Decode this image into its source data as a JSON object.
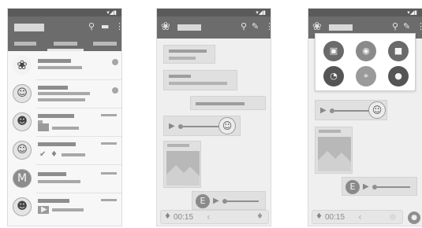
{
  "status": {
    "icons": "▾◢▮"
  },
  "chat_list": {
    "header_icons": {
      "search": "⚲",
      "compose": "▬",
      "menu": "⋮"
    },
    "rows": [
      {
        "avatar": "❀"
      },
      {
        "avatar": "☺"
      },
      {
        "avatar": "☻"
      },
      {
        "avatar": "☺"
      },
      {
        "avatar": "M"
      },
      {
        "avatar": "☻"
      }
    ]
  },
  "conversation": {
    "logo": "❀",
    "header_icons": {
      "search": "⚲",
      "attach": "✎",
      "menu": "⋮"
    },
    "voice_avatar": "☺",
    "voice_sender_initial": "E",
    "input": {
      "mic": "♦",
      "timer": "00:15",
      "chevron": "‹",
      "mic2": "♦"
    }
  },
  "attachments": {
    "logo": "❀",
    "header_icons": {
      "search": "⚲",
      "attach": "✎",
      "menu": "⋮"
    },
    "items": [
      {
        "icon": "▣",
        "color": "#6a6a6a"
      },
      {
        "icon": "◉",
        "color": "#7a7a7a"
      },
      {
        "icon": "■",
        "color": "#6a6a6a"
      },
      {
        "icon": "◔",
        "color": "#555555"
      },
      {
        "icon": "⌖",
        "color": "#9a9a9a"
      },
      {
        "icon": "●",
        "color": "#555555"
      }
    ],
    "voice_avatar": "☺",
    "voice_sender_initial": "E",
    "input": {
      "mic": "♦",
      "timer": "00:15",
      "chevron": "‹",
      "send": "●"
    }
  }
}
